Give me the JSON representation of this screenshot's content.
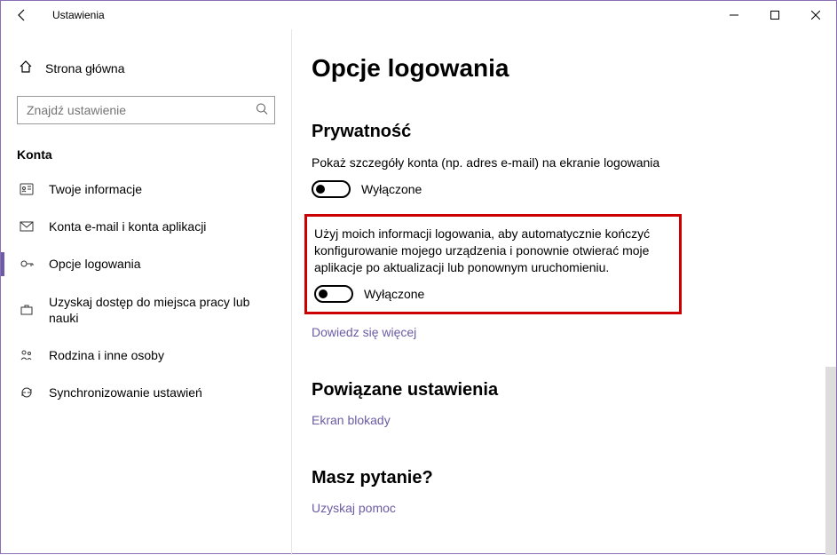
{
  "window": {
    "title": "Ustawienia"
  },
  "sidebar": {
    "home": "Strona główna",
    "search_placeholder": "Znajdź ustawienie",
    "group": "Konta",
    "items": [
      {
        "label": "Twoje informacje"
      },
      {
        "label": "Konta e-mail i konta aplikacji"
      },
      {
        "label": "Opcje logowania"
      },
      {
        "label": "Uzyskaj dostęp do miejsca pracy lub nauki"
      },
      {
        "label": "Rodzina i inne osoby"
      },
      {
        "label": "Synchronizowanie ustawień"
      }
    ]
  },
  "main": {
    "title": "Opcje logowania",
    "privacy_heading": "Prywatność",
    "privacy_desc1": "Pokaż szczegóły konta (np. adres e-mail) na ekranie logowania",
    "toggle1_state": "Wyłączone",
    "privacy_desc2": "Użyj moich informacji logowania, aby automatycznie kończyć konfigurowanie mojego urządzenia i ponownie otwierać moje aplikacje po aktualizacji lub ponownym uruchomieniu.",
    "toggle2_state": "Wyłączone",
    "learn_more": "Dowiedz się więcej",
    "related_heading": "Powiązane ustawienia",
    "related_link": "Ekran blokady",
    "question_heading": "Masz pytanie?",
    "help_link": "Uzyskaj pomoc"
  }
}
